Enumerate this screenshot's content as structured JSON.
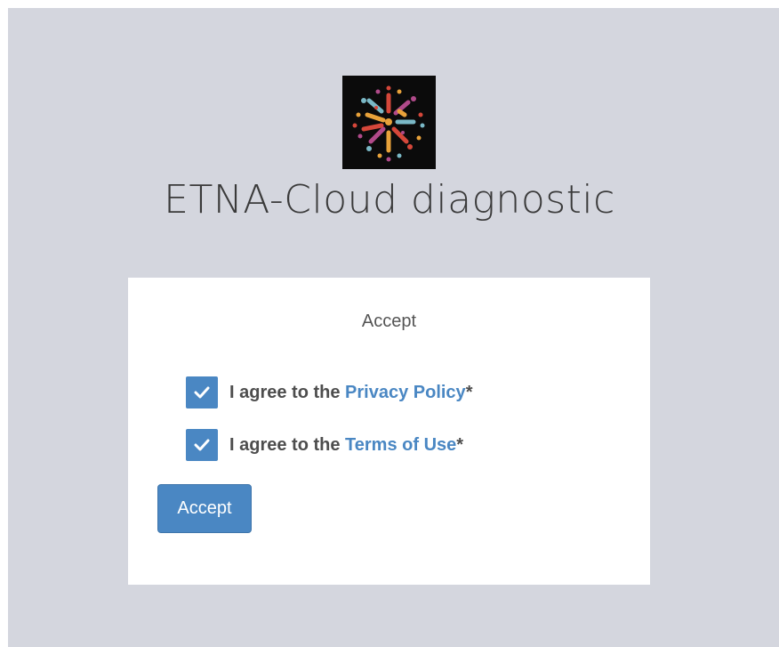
{
  "app": {
    "title": "ETNA-Cloud diagnostic",
    "logo_icon": "dot-burst-logo"
  },
  "card": {
    "title": "Accept",
    "agreements": [
      {
        "checked": true,
        "prefix": "I agree to the ",
        "link": "Privacy Policy",
        "suffix": "*"
      },
      {
        "checked": true,
        "prefix": "I agree to the ",
        "link": "Terms of Use",
        "suffix": "*"
      }
    ],
    "accept_button": "Accept"
  },
  "colors": {
    "background": "#d4d6de",
    "card": "#ffffff",
    "accent": "#4a87c3",
    "text": "#4d4d4d"
  }
}
